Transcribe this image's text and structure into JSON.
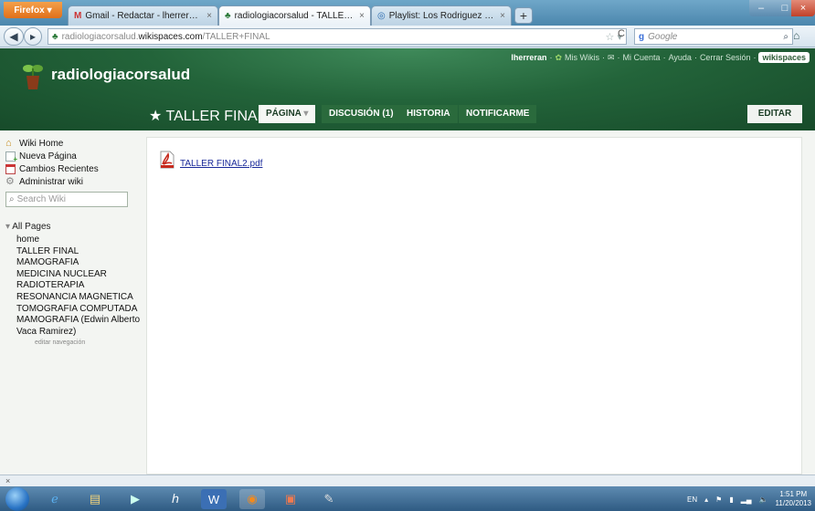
{
  "browser": {
    "firefox_label": "Firefox",
    "tabs": [
      {
        "label": "Gmail - Redactar - lherreranieves@g...",
        "active": false
      },
      {
        "label": "radiologiacorsalud - TALLER FINAL",
        "active": true
      },
      {
        "label": "Playlist: Los Rodriguez - goear.com",
        "active": false
      }
    ],
    "new_tab": "+",
    "url_prefix": "radiologiacorsalud.",
    "url_domain": "wikispaces.com",
    "url_path": "/TALLER+FINAL",
    "search_placeholder": "Google"
  },
  "wiki": {
    "site_name": "radiologiacorsalud",
    "user": "lherreran",
    "user_links": [
      "Mis Wikis",
      "Mi Cuenta",
      "Ayuda",
      "Cerrar Sesión"
    ],
    "wikispaces_badge": "wikispaces",
    "page_title": "TALLER FINAL",
    "tabs": {
      "pagina": "PÁGINA",
      "discusion": "DISCUSIÓN (1)",
      "historia": "HISTORIA",
      "notificarme": "NOTIFICARME",
      "editar": "EDITAR"
    }
  },
  "sidebar": {
    "links": {
      "wiki_home": "Wiki Home",
      "nueva_pagina": "Nueva Página",
      "cambios": "Cambios Recientes",
      "admin": "Administrar wiki"
    },
    "search_placeholder": "Search Wiki",
    "all_pages": "All Pages",
    "pages": [
      "home",
      "TALLER FINAL",
      "MAMOGRAFIA",
      "MEDICINA NUCLEAR",
      "RADIOTERAPIA",
      "RESONANCIA MAGNETICA",
      "TOMOGRAFIA COMPUTADA",
      "MAMOGRAFIA (Edwin Alberto",
      "Vaca Ramirez)"
    ],
    "edit_nav": "editar navegación"
  },
  "content": {
    "file_link": "TALLER FINAL2.pdf"
  },
  "status": {
    "close_x": "×"
  },
  "tray": {
    "lang": "EN",
    "time": "1:51 PM",
    "date": "11/20/2013"
  },
  "colors": {
    "header_green": "#23643a",
    "link_blue": "#1a2a9a"
  }
}
